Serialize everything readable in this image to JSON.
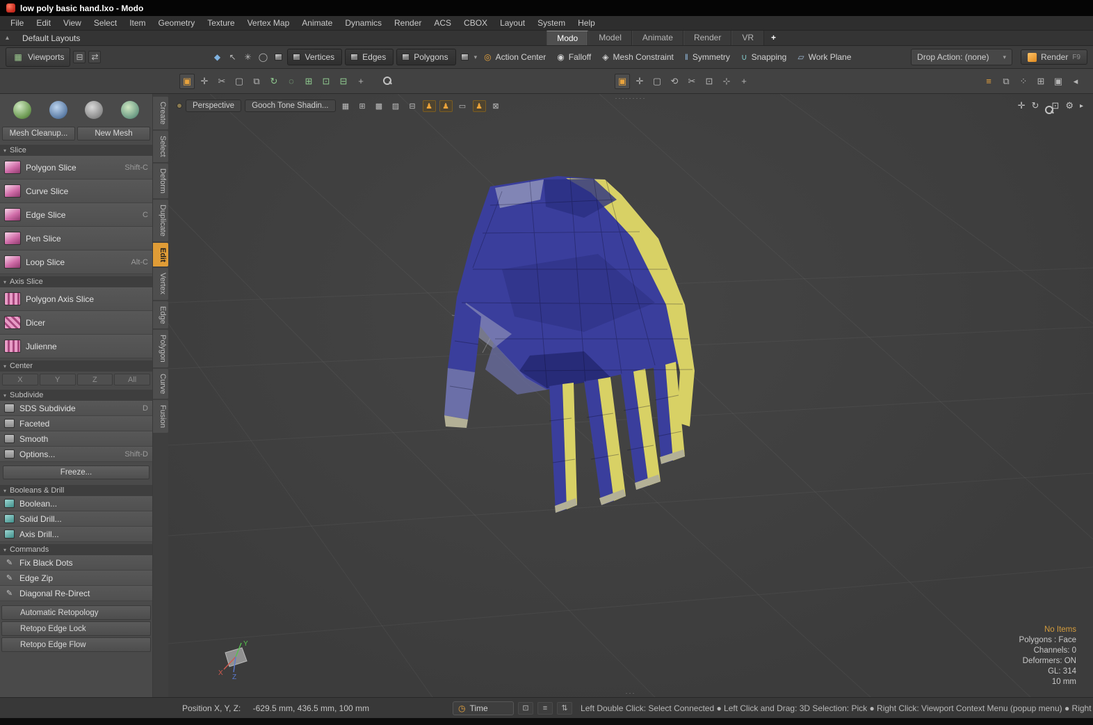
{
  "window": {
    "title": "low poly basic hand.lxo - Modo"
  },
  "menu_bar": {
    "items": [
      "File",
      "Edit",
      "View",
      "Select",
      "Item",
      "Geometry",
      "Texture",
      "Vertex Map",
      "Animate",
      "Dynamics",
      "Render",
      "ACS",
      "CBOX",
      "Layout",
      "System",
      "Help"
    ]
  },
  "layout_bar": {
    "preset_label": "Default Layouts",
    "tabs": [
      "Modo",
      "Model",
      "Animate",
      "Render",
      "VR"
    ],
    "active_tab": "Modo",
    "add_tab": "+"
  },
  "toolbar": {
    "viewports_label": "Viewports",
    "vertices_label": "Vertices",
    "edges_label": "Edges",
    "polygons_label": "Polygons",
    "action_center_label": "Action Center",
    "falloff_label": "Falloff",
    "mesh_constraint_label": "Mesh Constraint",
    "symmetry_label": "Symmetry",
    "snapping_label": "Snapping",
    "work_plane_label": "Work Plane",
    "drop_action_label": "Drop Action: (none)",
    "render_label": "Render",
    "render_shortcut": "F9"
  },
  "left_panel": {
    "top_buttons": [
      {
        "label": "Mesh Cleanup..."
      },
      {
        "label": "New Mesh"
      }
    ],
    "slice": {
      "header": "Slice",
      "items": [
        {
          "label": "Polygon Slice",
          "shortcut": "Shift-C"
        },
        {
          "label": "Curve Slice",
          "shortcut": ""
        },
        {
          "label": "Edge Slice",
          "shortcut": "C"
        },
        {
          "label": "Pen Slice",
          "shortcut": ""
        },
        {
          "label": "Loop Slice",
          "shortcut": "Alt-C"
        }
      ]
    },
    "axis_slice": {
      "header": "Axis Slice",
      "items": [
        {
          "label": "Polygon Axis Slice",
          "shortcut": ""
        },
        {
          "label": "Dicer",
          "shortcut": ""
        },
        {
          "label": "Julienne",
          "shortcut": ""
        }
      ]
    },
    "center": {
      "header": "Center",
      "buttons": [
        "X",
        "Y",
        "Z",
        "All"
      ]
    },
    "subdivide": {
      "header": "Subdivide",
      "items": [
        {
          "label": "SDS Subdivide",
          "shortcut": "D"
        },
        {
          "label": "Faceted",
          "shortcut": ""
        },
        {
          "label": "Smooth",
          "shortcut": ""
        },
        {
          "label": "Options...",
          "shortcut": "Shift-D"
        }
      ]
    },
    "freeze_label": "Freeze...",
    "booleans": {
      "header": "Booleans & Drill",
      "items": [
        {
          "label": "Boolean...",
          "shortcut": ""
        },
        {
          "label": "Solid Drill...",
          "shortcut": ""
        },
        {
          "label": "Axis Drill...",
          "shortcut": ""
        }
      ]
    },
    "commands": {
      "header": "Commands",
      "items": [
        {
          "label": "Fix Black Dots",
          "shortcut": ""
        },
        {
          "label": "Edge Zip",
          "shortcut": ""
        },
        {
          "label": "Diagonal Re-Direct",
          "shortcut": ""
        }
      ]
    },
    "bottom_buttons": [
      {
        "label": "Automatic Retopology"
      },
      {
        "label": "Retopo Edge Lock"
      },
      {
        "label": "Retopo Edge Flow"
      }
    ]
  },
  "tool_tabs": {
    "items": [
      "Create",
      "Select",
      "Deform",
      "Duplicate",
      "Edit",
      "Vertex",
      "Edge",
      "Polygon",
      "Curve",
      "Fusion"
    ],
    "active": "Edit"
  },
  "viewport": {
    "camera_label": "Perspective",
    "shading_label": "Gooch Tone Shadin...",
    "stats": {
      "items_label": "No Items",
      "selection_mode": "Polygons : Face",
      "channels": "Channels: 0",
      "deformers": "Deformers: ON",
      "gl": "GL: 314",
      "grid_size": "10 mm"
    },
    "axis_gizmo": {
      "x": "X",
      "y": "Y",
      "z": "Z"
    }
  },
  "status_bar": {
    "position_label": "Position X, Y, Z:",
    "position_value": "-629.5 mm, 436.5 mm, 100 mm",
    "time_label": "Time",
    "help_text": "Left Double Click: Select Connected ● Left Click and Drag: 3D Selection: Pick ● Right Click: Viewport Context Menu (popup menu) ● Right Click and Dra..."
  },
  "colors": {
    "accent_orange": "#e8a33d",
    "hand_blue": "#3a3e9c",
    "hand_yellow": "#d8d165",
    "viewport_bg": "#404040"
  }
}
